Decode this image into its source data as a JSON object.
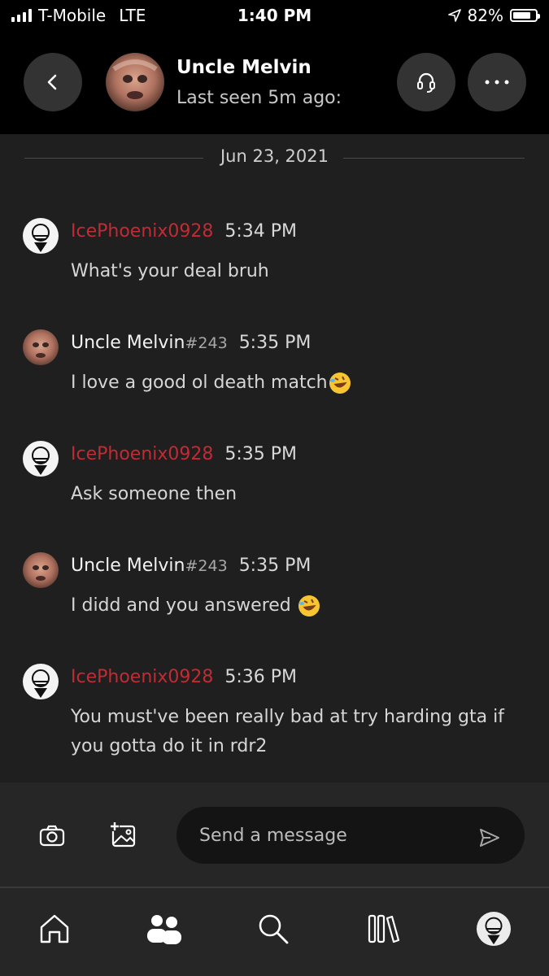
{
  "status_bar": {
    "carrier": "T-Mobile",
    "network": "LTE",
    "time": "1:40 PM",
    "battery": "82%",
    "battery_level": 0.82
  },
  "header": {
    "contact_name": "Uncle Melvin",
    "contact_status": "Last seen 5m ago:",
    "back_icon": "chevron-left-icon",
    "call_icon": "headset-icon",
    "more_icon": "more-horizontal-icon"
  },
  "date_divider": "Jun 23, 2021",
  "messages": [
    {
      "author": "IcePhoenix0928",
      "tag": "",
      "time": "5:34 PM",
      "text": "What's your deal bruh",
      "emoji": ""
    },
    {
      "author": "Uncle Melvin",
      "tag": "#243",
      "time": "5:35 PM",
      "text": "I love a good ol death match",
      "emoji": "rolling-on-floor-laughing-emoji"
    },
    {
      "author": "IcePhoenix0928",
      "tag": "",
      "time": "5:35 PM",
      "text": "Ask someone then",
      "emoji": ""
    },
    {
      "author": "Uncle Melvin",
      "tag": "#243",
      "time": "5:35 PM",
      "text": "I didd and you answered ",
      "emoji": "rolling-on-floor-laughing-emoji"
    },
    {
      "author": "IcePhoenix0928",
      "tag": "",
      "time": "5:36 PM",
      "text": "You must've been really bad at try harding gta if you gotta do it in rdr2",
      "emoji": ""
    }
  ],
  "composer": {
    "placeholder": "Send a message",
    "camera_icon": "camera-icon",
    "image_icon": "add-image-icon",
    "send_icon": "send-icon"
  },
  "tabbar": {
    "items": [
      "home-icon",
      "friends-icon",
      "search-icon",
      "library-icon",
      "profile-avatar"
    ]
  },
  "colors": {
    "accent_red": "#c12b34",
    "background": "#1f1f1f",
    "header": "#000000"
  }
}
